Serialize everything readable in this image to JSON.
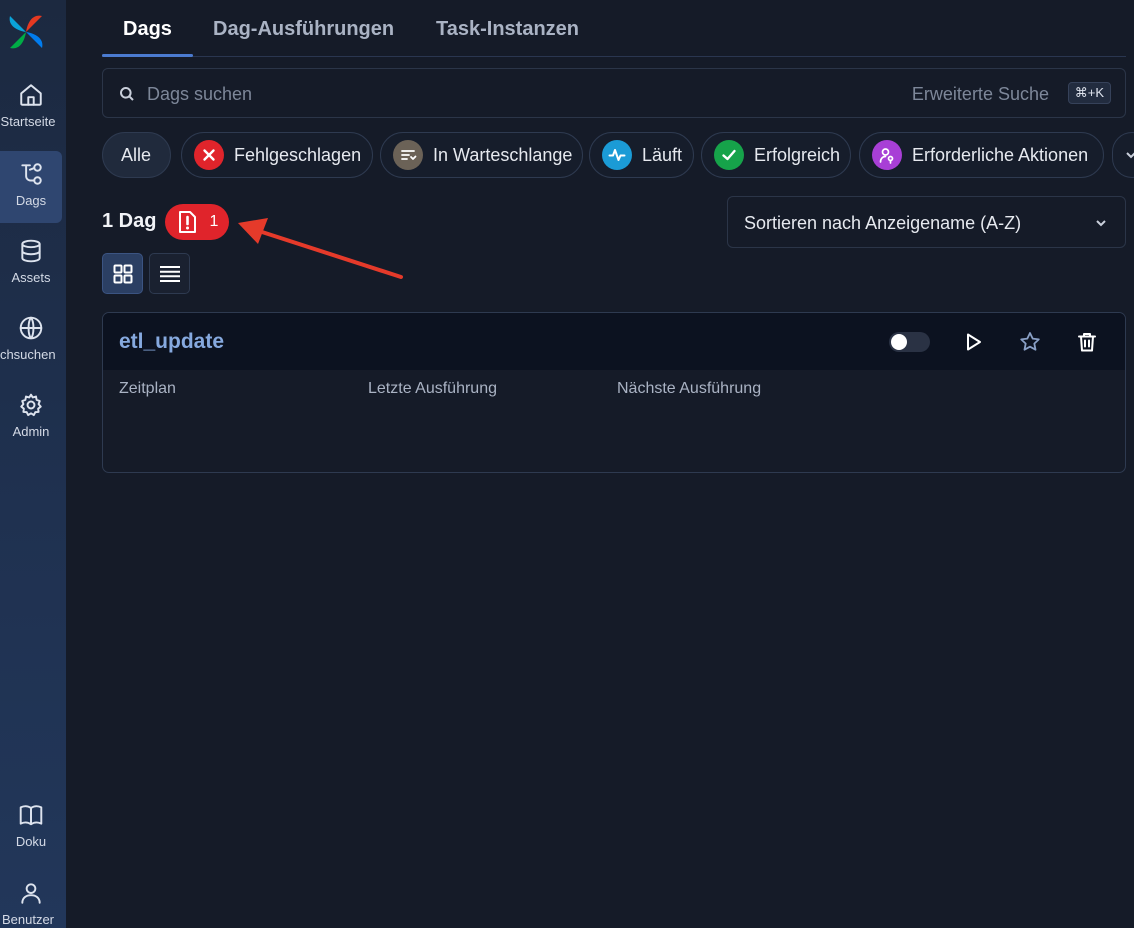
{
  "sidebar": {
    "items": [
      {
        "label": "Startseite",
        "icon": "home-icon"
      },
      {
        "label": "Dags",
        "icon": "dags-icon",
        "active": true
      },
      {
        "label": "Assets",
        "icon": "database-icon"
      },
      {
        "label": "Durchsuchen",
        "icon": "globe-icon"
      },
      {
        "label": "Admin",
        "icon": "gear-icon"
      },
      {
        "label": "Doku",
        "icon": "book-icon"
      },
      {
        "label": "Benutzer",
        "icon": "user-icon"
      }
    ],
    "visible_labels": [
      "Startseite",
      "Dags",
      "Assets",
      "urchsuchen",
      "Admin",
      "Doku",
      "Benutzer"
    ]
  },
  "tabs": [
    {
      "label": "Dags",
      "active": true
    },
    {
      "label": "Dag-Ausführungen"
    },
    {
      "label": "Task-Instanzen"
    }
  ],
  "search": {
    "placeholder": "Dags suchen",
    "value": "",
    "advanced_label": "Erweiterte Suche",
    "shortcut": "⌘+K"
  },
  "filters": [
    {
      "label": "Alle"
    },
    {
      "label": "Fehlgeschlagen",
      "icon": "x-icon",
      "color": "#e0242b"
    },
    {
      "label": "In Warteschlange",
      "icon": "queue-icon",
      "color": "#6b6257"
    },
    {
      "label": "Läuft",
      "icon": "pulse-icon",
      "color": "#1b9bd6"
    },
    {
      "label": "Erfolgreich",
      "icon": "check-icon",
      "color": "#16a34a"
    },
    {
      "label": "Erforderliche Aktionen",
      "icon": "user-key-icon",
      "color": "#a83fd6"
    }
  ],
  "summary": {
    "count_label": "1 Dag",
    "error_count": "1",
    "error_color": "#e0242b"
  },
  "sort": {
    "selected": "Sortieren nach Anzeigename (A-Z)"
  },
  "view_modes": [
    "grid-view",
    "list-view"
  ],
  "dags": [
    {
      "name": "etl_update",
      "paused": true,
      "columns": [
        "Zeitplan",
        "Letzte Ausführung",
        "Nächste Ausführung"
      ]
    }
  ],
  "colors": {
    "background": "#151b28",
    "sidebar": "#1f3150",
    "accent": "#4b7bd0",
    "dag_link": "#86a9df",
    "annotation_arrow": "#e53a2a"
  }
}
